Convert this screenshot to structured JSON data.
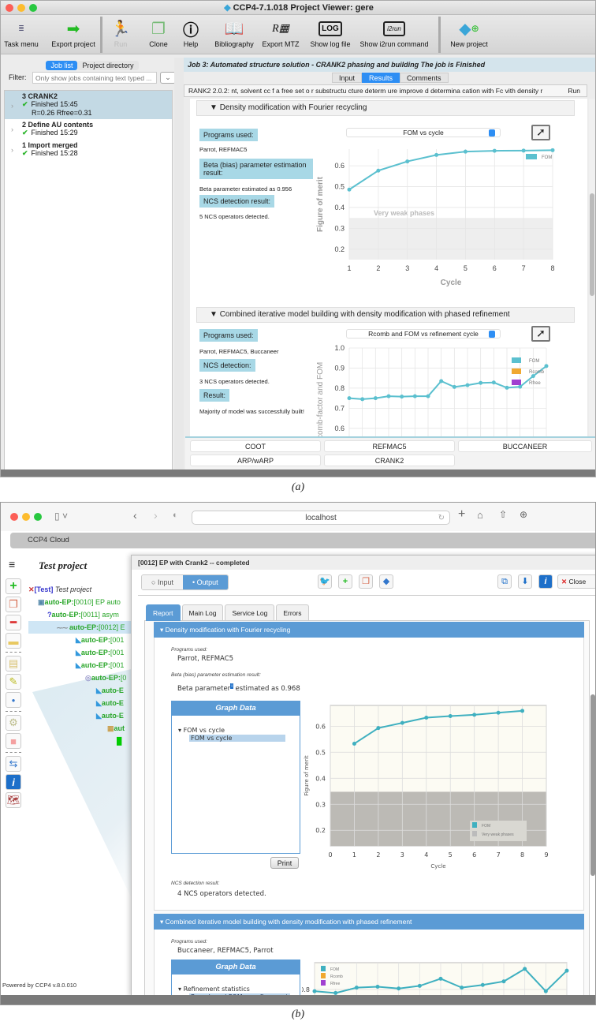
{
  "panel_a": {
    "window_title": "CCP4-7.1.018 Project Viewer: gere",
    "toolbar": [
      {
        "label": "Task menu",
        "icon": "task-menu-icon"
      },
      {
        "label": "Export project",
        "icon": "export-icon"
      },
      {
        "label": "Run",
        "icon": "run-icon",
        "disabled": true
      },
      {
        "label": "Clone",
        "icon": "clone-icon"
      },
      {
        "label": "Help",
        "icon": "help-icon"
      },
      {
        "label": "Bibliography",
        "icon": "book-icon"
      },
      {
        "label": "Export MTZ",
        "icon": "mtz-icon"
      },
      {
        "label": "Show log file",
        "icon": "log-icon"
      },
      {
        "label": "Show i2run command",
        "icon": "i2run-icon"
      },
      {
        "label": "New project",
        "icon": "new-project-icon"
      }
    ],
    "left_tabs": {
      "job_list": "Job list",
      "project_directory": "Project directory"
    },
    "filter": {
      "label": "Filter:",
      "placeholder": "Only show jobs containing text typed ..."
    },
    "jobs": [
      {
        "title": "3 CRANK2",
        "status": "Finished 15:45",
        "extra": "R=0.26 Rfree=0.31"
      },
      {
        "title": "2 Define AU contents",
        "status": "Finished 15:29",
        "extra": ""
      },
      {
        "title": "1 Import merged",
        "status": "Finished 15:28",
        "extra": ""
      }
    ],
    "job_header": "Job 3:  Automated structure solution - CRANK2 phasing and building   The job is Finished",
    "result_tabs": [
      "Input",
      "Results",
      "Comments"
    ],
    "summary_text": "RANK2 2.0.2: nt, solvent cc f a free set o r substructu cture determ ure improve d determina cation with Fc vith density r",
    "summary_run": "Run",
    "section1": {
      "title": "Density modification with Fourier recycling",
      "programs_label": "Programs used:",
      "programs": "Parrot, REFMAC5",
      "beta_label": "Beta (bias) parameter estimation result:",
      "beta_text": "Beta parameter estimated as 0.956",
      "ncs_label": "NCS detection result:",
      "ncs_text": "5 NCS operators detected.",
      "graph_select": "FOM vs cycle"
    },
    "section2": {
      "title": "Combined iterative model building with density modification with phased refinement",
      "programs_label": "Programs used:",
      "programs": "Parrot, REFMAC5, Buccaneer",
      "ncs_label": "NCS detection:",
      "ncs_text": "3 NCS operators detected.",
      "result_label": "Result:",
      "result_text": "Majority of model was successfully built!",
      "graph_select": "Rcomb and FOM vs refinement cycle"
    },
    "app_buttons": [
      "COOT",
      "REFMAC5",
      "BUCCANEER",
      "ARP/wARP",
      "CRANK2"
    ],
    "caption": "(a)"
  },
  "panel_b": {
    "url": "localhost",
    "app_tab": "CCP4 Cloud",
    "project_title": "Test project",
    "tree": [
      {
        "tag": "[Test]",
        "text": " Test project",
        "level": 0
      },
      {
        "tag": "auto-EP:",
        "text": "[0010] EP auto",
        "level": 1
      },
      {
        "tag": "auto-EP:",
        "text": "[0011] asym",
        "level": 2
      },
      {
        "tag": "auto-EP:",
        "text": "[0012] E",
        "level": 3
      },
      {
        "tag": "auto-EP:",
        "text": "[001",
        "level": 4
      },
      {
        "tag": "auto-EP:",
        "text": "[001",
        "level": 4
      },
      {
        "tag": "auto-EP:",
        "text": "[001",
        "level": 4
      },
      {
        "tag": "auto-EP:",
        "text": "[0",
        "level": 5
      },
      {
        "tag": "auto-E",
        "text": "",
        "level": 6
      },
      {
        "tag": "auto-E",
        "text": "",
        "level": 6
      },
      {
        "tag": "auto-E",
        "text": "",
        "level": 6
      },
      {
        "tag": "aut",
        "text": "",
        "level": 7
      }
    ],
    "powered_by": "Powered by CCP4 v.8.0.010",
    "dialog_title": "[0012] EP with Crank2 -- completed",
    "io_switch": [
      "Input",
      "Output"
    ],
    "close_label": "Close",
    "report_tabs": [
      "Report",
      "Main Log",
      "Service Log",
      "Errors"
    ],
    "section1": {
      "title": "Density modification with Fourier recycling",
      "programs_label": "Programs used:",
      "programs": "Parrot, REFMAC5",
      "beta_label": "Beta (bias) parameter estimation result:",
      "beta_text_pre": "Beta parameter",
      "beta_text_post": " estimated as 0.968",
      "graph_data_title": "Graph Data",
      "graph_tree_parent": "FOM vs cycle",
      "graph_tree_child": "FOM vs cycle",
      "print_label": "Print",
      "ncs_label": "NCS detection result:",
      "ncs_text": "4 NCS operators detected."
    },
    "section2": {
      "title": "Combined iterative model building with density modification with phased refinement",
      "programs_label": "Programs used:",
      "programs": "Buccaneer, REFMAC5, Parrot",
      "graph_data_title": "Graph Data",
      "graph_tree_parent": "Refinement statistics",
      "graph_tree_child": "Rcomb and FOM vs refinement"
    },
    "caption": "(b)"
  },
  "chart_data": [
    {
      "id": "a1",
      "type": "line",
      "title": "FOM vs cycle",
      "xlabel": "Cycle",
      "ylabel": "Figure of merit",
      "x": [
        1,
        2,
        3,
        4,
        5,
        6,
        7,
        8
      ],
      "xlim": [
        1,
        8
      ],
      "ylim": [
        0.15,
        0.68
      ],
      "xticks": [
        1,
        2,
        3,
        4,
        5,
        6,
        7,
        8
      ],
      "yticks": [
        0.2,
        0.3,
        0.4,
        0.5,
        0.6
      ],
      "series": [
        {
          "name": "FOM",
          "color": "#5bc0cf",
          "values": [
            0.486,
            0.577,
            0.621,
            0.652,
            0.668,
            0.672,
            0.673,
            0.675
          ]
        }
      ],
      "band": {
        "label": "Very weak phases",
        "from": 0.15,
        "to": 0.35
      },
      "legend": "top-right",
      "grid": true
    },
    {
      "id": "a2",
      "type": "line",
      "title": "Rcomb and FOM vs refinement cycle",
      "xlabel": "",
      "ylabel": "Rcomb-factor and FOM",
      "x": [
        1,
        2,
        3,
        4,
        5,
        6,
        7,
        8,
        9,
        10,
        11,
        12,
        13,
        14,
        15,
        16
      ],
      "ylim": [
        0.45,
        1.0
      ],
      "yticks": [
        0.5,
        0.6,
        0.7,
        0.8,
        0.9,
        1.0
      ],
      "series": [
        {
          "name": "FOM",
          "color": "#5bc0cf",
          "values": [
            0.75,
            0.745,
            0.75,
            0.76,
            0.758,
            0.76,
            0.76,
            0.835,
            0.806,
            0.815,
            0.826,
            0.828,
            0.802,
            0.807,
            0.86,
            0.91
          ]
        },
        {
          "name": "Rcomb",
          "color": "#f0a830",
          "values": []
        },
        {
          "name": "Rfree",
          "color": "#a040d0",
          "values": []
        }
      ],
      "legend": "top-right",
      "grid": true
    },
    {
      "id": "b1",
      "type": "line",
      "title": "FOM vs cycle",
      "xlabel": "Cycle",
      "ylabel": "Figure of merit",
      "x": [
        1,
        2,
        3,
        4,
        5,
        6,
        7,
        8
      ],
      "xlim": [
        0,
        9
      ],
      "ylim": [
        0.14,
        0.68
      ],
      "xticks": [
        0,
        1,
        2,
        3,
        4,
        5,
        6,
        7,
        8,
        9
      ],
      "yticks": [
        0.2,
        0.3,
        0.4,
        0.5,
        0.6
      ],
      "series": [
        {
          "name": "FOM",
          "color": "#3fb0c0",
          "values": [
            0.533,
            0.593,
            0.613,
            0.633,
            0.639,
            0.644,
            0.652,
            0.659
          ]
        }
      ],
      "band": {
        "label": "Very weak phases",
        "from": 0.14,
        "to": 0.348
      },
      "legend": "bottom-right",
      "grid": true
    },
    {
      "id": "b2",
      "type": "line",
      "title": "Rcomb and FOM vs refinement",
      "xlabel": "",
      "ylabel": "",
      "x": [
        1,
        2,
        3,
        4,
        5,
        6,
        7,
        8,
        9,
        10,
        11,
        12,
        13,
        14,
        15,
        16
      ],
      "ylim": [
        0.72,
        0.95
      ],
      "yticks": [
        0.8
      ],
      "series": [
        {
          "name": "FOM",
          "color": "#3fb0c0",
          "values": [
            0.79,
            0.78,
            0.81,
            0.815,
            0.805,
            0.82,
            0.86,
            0.81,
            0.825,
            0.845,
            0.915,
            0.79,
            0.905
          ]
        },
        {
          "name": "Rcomb",
          "color": "#f0a830",
          "values": []
        },
        {
          "name": "Rfree",
          "color": "#a040d0",
          "values": []
        }
      ],
      "legend": "top-left",
      "grid": true
    }
  ]
}
